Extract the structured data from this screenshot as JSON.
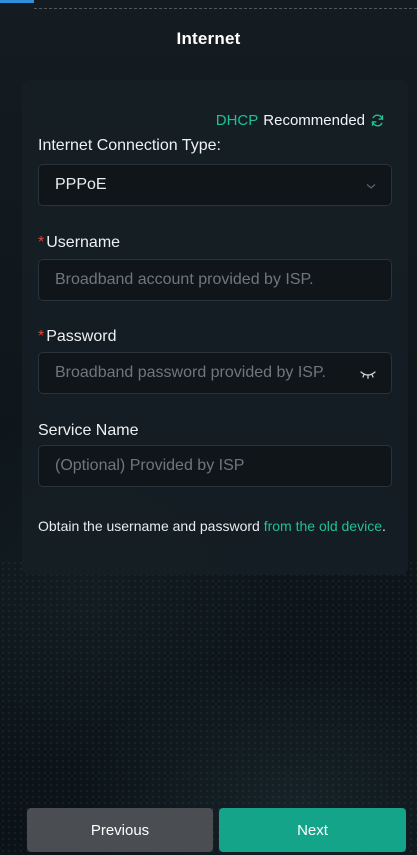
{
  "header": {
    "title": "Internet"
  },
  "recommend": {
    "protocol": "DHCP",
    "text": "Recommended"
  },
  "connection": {
    "label": "Internet Connection Type:",
    "value": "PPPoE"
  },
  "username": {
    "label": "Username",
    "placeholder": "Broadband account provided by ISP."
  },
  "password": {
    "label": "Password",
    "placeholder": "Broadband password provided by ISP."
  },
  "service": {
    "label": "Service Name",
    "placeholder": "(Optional) Provided by ISP"
  },
  "hint": {
    "text": "Obtain the username and password ",
    "link": "from the old device",
    "end": "."
  },
  "buttons": {
    "previous": "Previous",
    "next": "Next"
  },
  "colors": {
    "accent": "#1ec09a",
    "required": "#e0453c",
    "primary_button": "#14a48a",
    "secondary_button": "#4a4d51"
  },
  "icons": {
    "refresh": "refresh-icon",
    "dropdown": "chevron-down-icon",
    "password_toggle": "eye-closed-icon"
  }
}
